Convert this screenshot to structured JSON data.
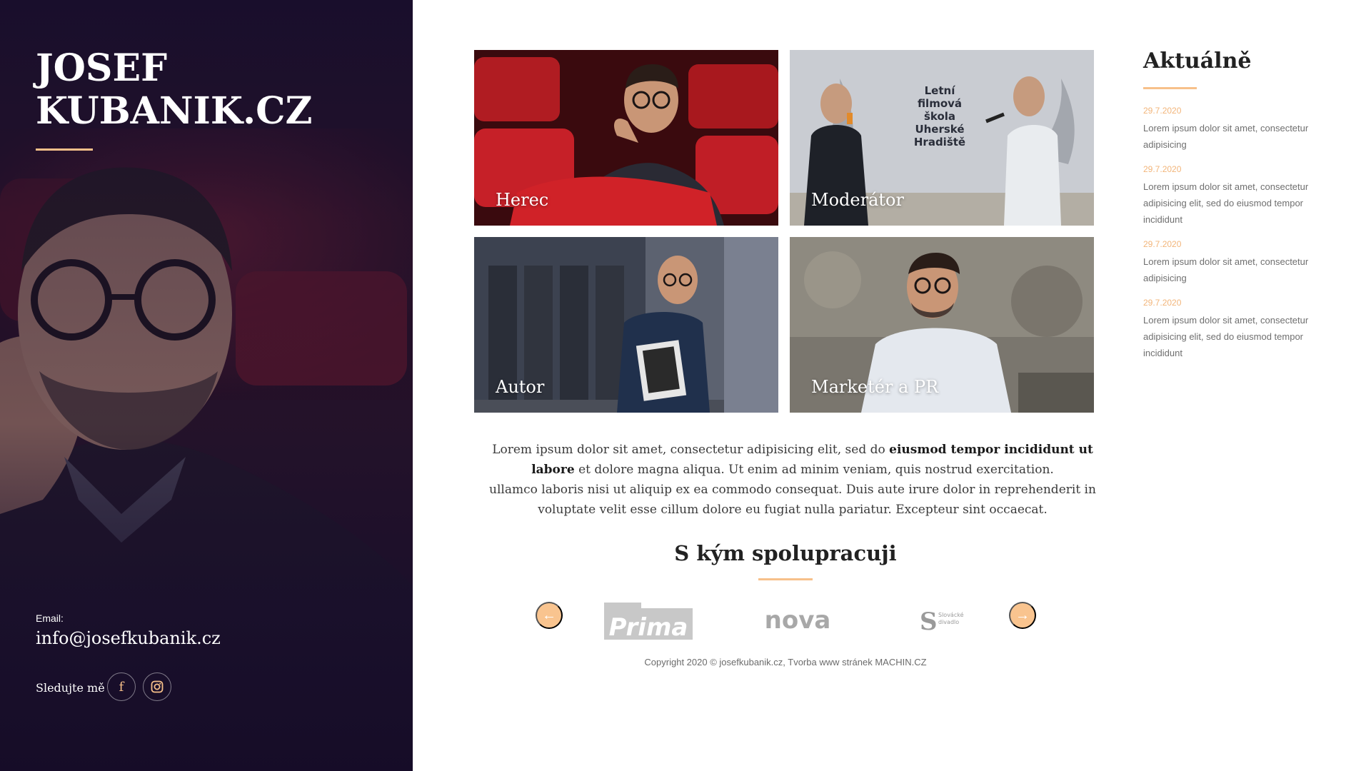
{
  "sidebar": {
    "title_line1": "JOSEF",
    "title_line2": "KUBANIK.CZ",
    "email_label": "Email:",
    "email": "info@josefkubanik.cz",
    "follow_label": "Sledujte mě",
    "social_icons": [
      "facebook-icon",
      "instagram-icon"
    ],
    "facebook_glyph": "f"
  },
  "tiles": [
    {
      "label": "Herec"
    },
    {
      "label": "Moderátor"
    },
    {
      "label": "Autor"
    },
    {
      "label": "Marketér a PR"
    }
  ],
  "banner": {
    "line1": "Letní",
    "line2": "filmová",
    "line3": "škola",
    "line4": "Uherské",
    "line5": "Hradiště"
  },
  "intro": {
    "part1": "Lorem ipsum dolor sit amet, consectetur adipisicing elit, sed do ",
    "bold": "eiusmod tempor incididunt ut labore",
    "part2": " et dolore magna aliqua. Ut enim ad minim veniam, quis nostrud exercitation.",
    "line2": "ullamco laboris nisi ut aliquip ex ea commodo consequat. Duis aute irure dolor in reprehenderit in voluptate velit esse cillum dolore eu fugiat nulla pariatur. Excepteur sint occaecat."
  },
  "partners": {
    "title": "S kým spolupracuji",
    "prev_glyph": "←",
    "next_glyph": "→",
    "logos": {
      "prima": "Prima",
      "nova": "nova",
      "slovacke_line1": "Slovácké",
      "slovacke_line2": "divadlo"
    }
  },
  "footer": {
    "copyright": "Copyright 2020 © josefkubanik.cz, Tvorba www stránek MACHIN.CZ"
  },
  "news": {
    "title": "Aktuálně",
    "items": [
      {
        "date": "29.7.2020",
        "text": "Lorem ipsum dolor sit amet, consectetur adipisicing"
      },
      {
        "date": "29.7.2020",
        "text": "Lorem ipsum dolor sit amet, consectetur adipisicing elit, sed do eiusmod tempor incididunt"
      },
      {
        "date": "29.7.2020",
        "text": "Lorem ipsum dolor sit amet, consectetur adipisicing"
      },
      {
        "date": "29.7.2020",
        "text": "Lorem ipsum dolor sit amet, consectetur adipisicing elit, sed do eiusmod tempor incididunt"
      }
    ]
  },
  "colors": {
    "accent": "#f7c08a",
    "sidebar_bg": "#1c1030",
    "date": "#f2b57a"
  }
}
